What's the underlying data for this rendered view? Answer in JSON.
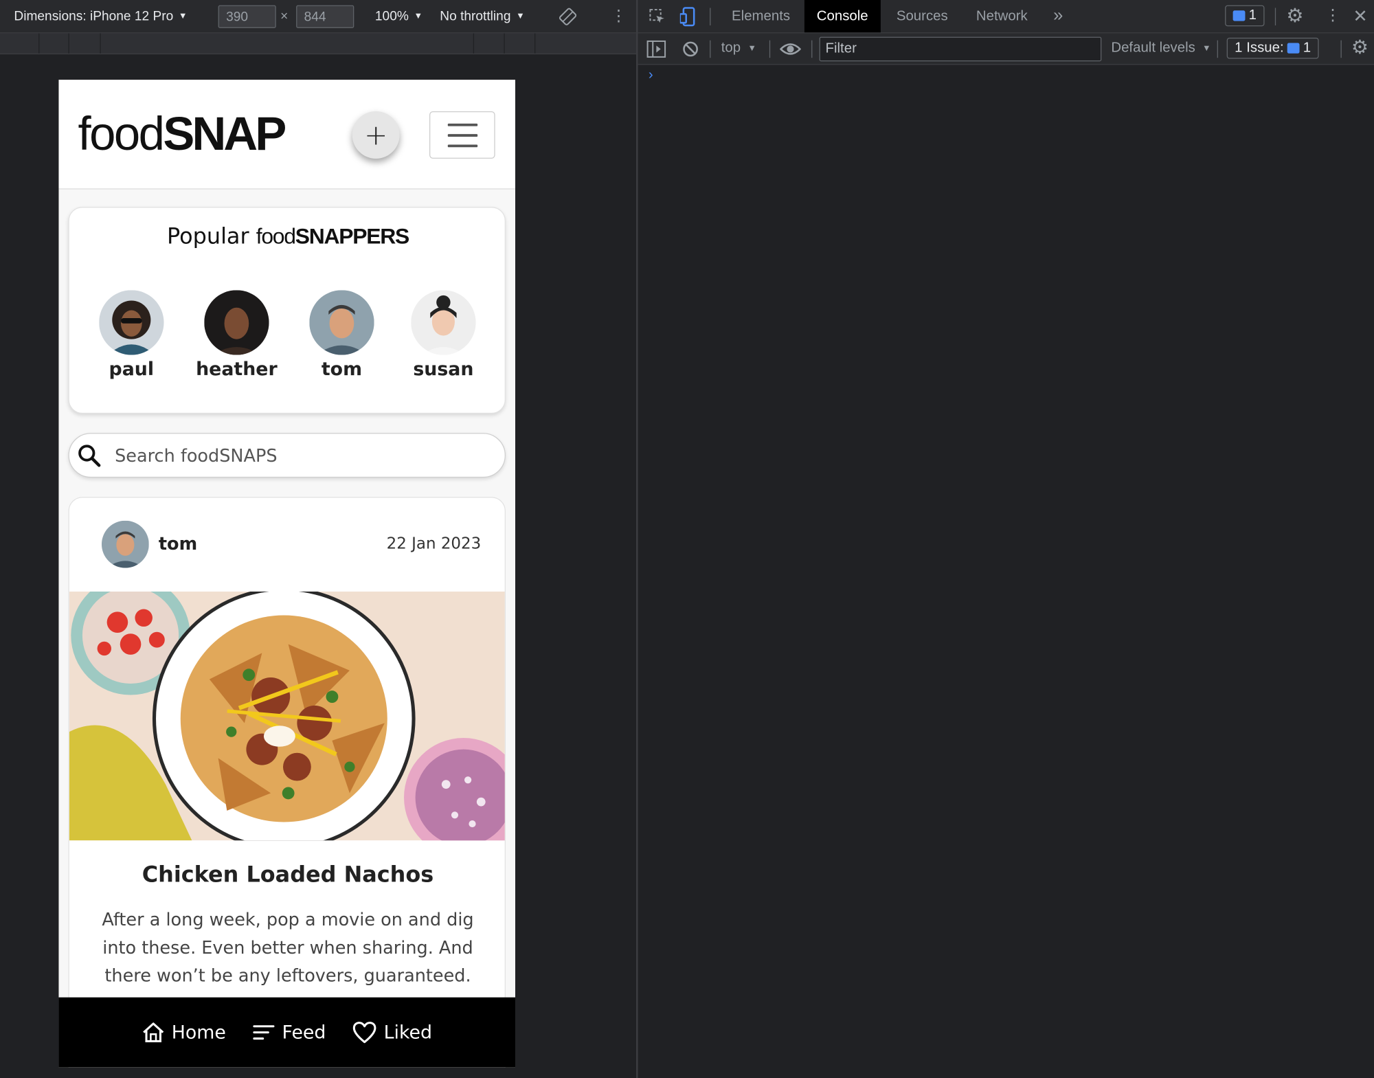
{
  "device_toolbar": {
    "dimensions_label": "Dimensions: iPhone 12 Pro",
    "width_value": "390",
    "times": "×",
    "height_value": "844",
    "zoom": "100%",
    "throttling": "No throttling"
  },
  "app": {
    "logo_thin": "food",
    "logo_bold": "SNAP",
    "add_label": "+",
    "popular": {
      "title_prefix": "Popular",
      "title_food": "food",
      "title_snappers": "SNAPPERS",
      "snappers": [
        {
          "name": "paul"
        },
        {
          "name": "heather"
        },
        {
          "name": "tom"
        },
        {
          "name": "susan"
        }
      ]
    },
    "search_placeholder": "Search foodSNAPS",
    "post": {
      "user": "tom",
      "date": "22 Jan 2023",
      "title": "Chicken Loaded Nachos",
      "description": "After a long week, pop a movie on and dig into these. Even better when sharing. And there won’t be any leftovers, guaranteed."
    },
    "nav": {
      "home": "Home",
      "feed": "Feed",
      "liked": "Liked"
    }
  },
  "devtools": {
    "tabs": [
      "Elements",
      "Console",
      "Sources",
      "Network"
    ],
    "more_tabs": "»",
    "active_tab": "Console",
    "messages_count": "1",
    "context": "top",
    "filter_placeholder": "Filter",
    "levels": "Default levels",
    "issues_label": "1 Issue:",
    "issues_count": "1",
    "prompt": "›"
  },
  "colors": {
    "devtools_bg": "#202124",
    "accent_blue": "#4a8bf5",
    "nav_bg": "#000000"
  }
}
